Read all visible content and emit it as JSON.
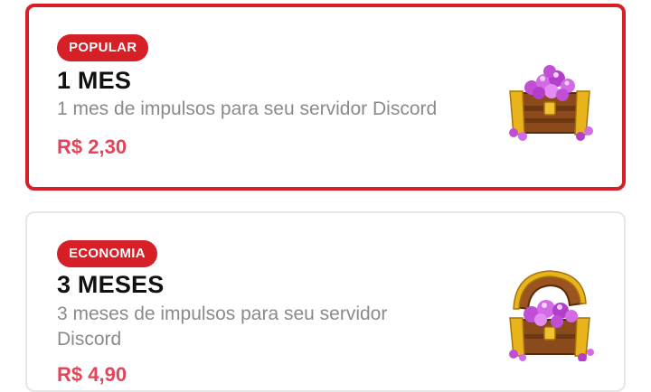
{
  "plans": [
    {
      "badge": "POPULAR",
      "title": "1 MES",
      "description": "1 mes de impulsos para seu servidor Discord",
      "price": "R$ 2,30",
      "icon": "gem-chest-icon"
    },
    {
      "badge": "ECONOMIA",
      "title": "3 MESES",
      "description": "3 meses de impulsos para seu servidor Discord",
      "price": "R$ 4,90",
      "icon": "open-gem-chest-icon"
    }
  ],
  "colors": {
    "accent": "#d61f26",
    "price": "#e3445a",
    "title": "#111111",
    "description": "#8a8a8a",
    "card_border": "#e6e6e6"
  }
}
